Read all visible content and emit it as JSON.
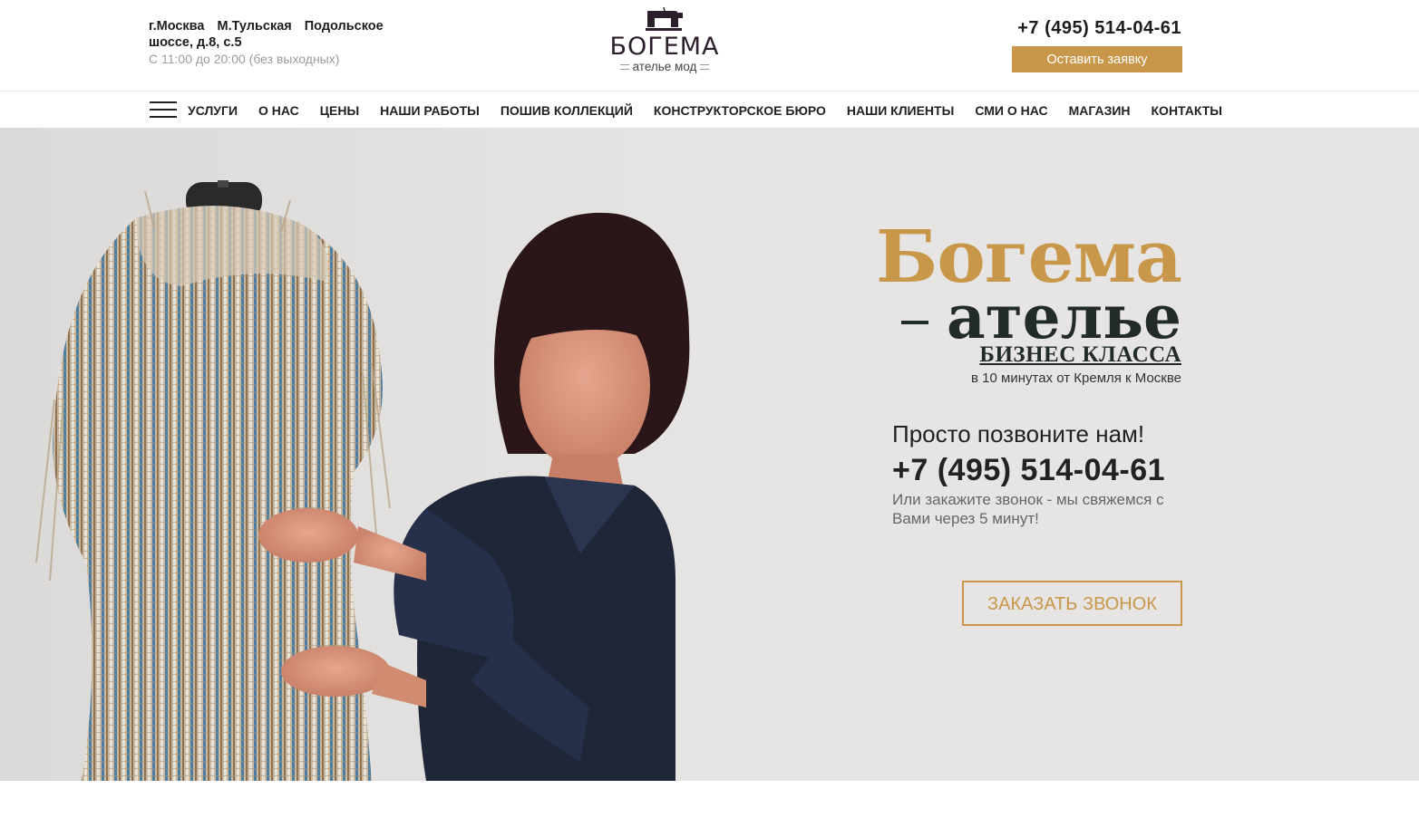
{
  "header": {
    "address_city": "г.Москва",
    "address_metro": "М.Тульская",
    "address_street": "Подольское шоссе, д.8, с.5",
    "hours": "С 11:00 до 20:00 (без выходных)",
    "logo_name": "БОГЕМА",
    "logo_sub": "ателье мод",
    "phone": "+7 (495) 514-04-61",
    "request_button": "Оставить заявку"
  },
  "nav": {
    "items": [
      "УСЛУГИ",
      "О НАС",
      "ЦЕНЫ",
      "НАШИ РАБОТЫ",
      "ПОШИВ КОЛЛЕКЦИЙ",
      "КОНСТРУКТОРСКОЕ БЮРО",
      "НАШИ КЛИЕНТЫ",
      "СМИ О НАС",
      "МАГАЗИН",
      "КОНТАКТЫ"
    ]
  },
  "hero": {
    "brand_line1": "Богема",
    "brand_line2": "ателье",
    "brand_line3": "БИЗНЕС КЛАССА",
    "brand_line4": "в 10 минутах от Кремля к Москве",
    "call_title": "Просто позвоните нам!",
    "call_phone": "+7 (495) 514-04-61",
    "call_text": "Или закажите звонок - мы свяжемся с Вами через 5 минут!",
    "call_button": "ЗАКАЗАТЬ ЗВОНОК"
  },
  "colors": {
    "accent": "#c9974a",
    "hero_bg": "#e6e5e4",
    "dark_text": "#222a2a"
  }
}
